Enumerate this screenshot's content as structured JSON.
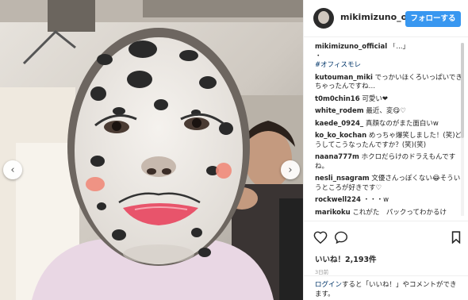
{
  "post": {
    "username": "mikimizuno_offici",
    "follow_label": "フォローする",
    "caption_user": "mikimizuno_official",
    "caption_text": "「...」",
    "caption_dot": "・",
    "hashtag": "#オフィスモレ",
    "likes": "いいね！2,193件",
    "date": "3日前"
  },
  "comments": [
    {
      "user": "kutouman_miki",
      "text": "でっかいほくろいっぱいできちゃったんですね…"
    },
    {
      "user": "t0m0chin16",
      "text": "可愛い❤"
    },
    {
      "user": "white_rodem",
      "text": "最近、変😋♡"
    },
    {
      "user": "kaede_0924_",
      "text": "真顔なのがまた面白いw"
    },
    {
      "user": "ko_ko_kochan",
      "text": "めっちゃ爆笑しました！(笑)どうしてこうなったんですか？(笑)(笑)"
    },
    {
      "user": "naana777m",
      "text": "ホクロだらけのドラえもんですね。"
    },
    {
      "user": "nesli_nsagram",
      "text": "文優さんっぽくない😂そういうところが好きです♡"
    },
    {
      "user": "rockwell224",
      "text": "・・・w"
    },
    {
      "user": "marikoku",
      "text": "これがた　パックってわかるけ"
    }
  ],
  "login": {
    "link": "ログイン",
    "text": "すると「いいね！」やコメントができます。"
  },
  "icons": {
    "heart": "heart-icon",
    "comment": "comment-icon",
    "bookmark": "bookmark-icon",
    "prev": "chevron-left-icon",
    "next": "chevron-right-icon"
  },
  "colors": {
    "follow_button": "#3897f0",
    "link": "#003569",
    "text": "#262626"
  }
}
